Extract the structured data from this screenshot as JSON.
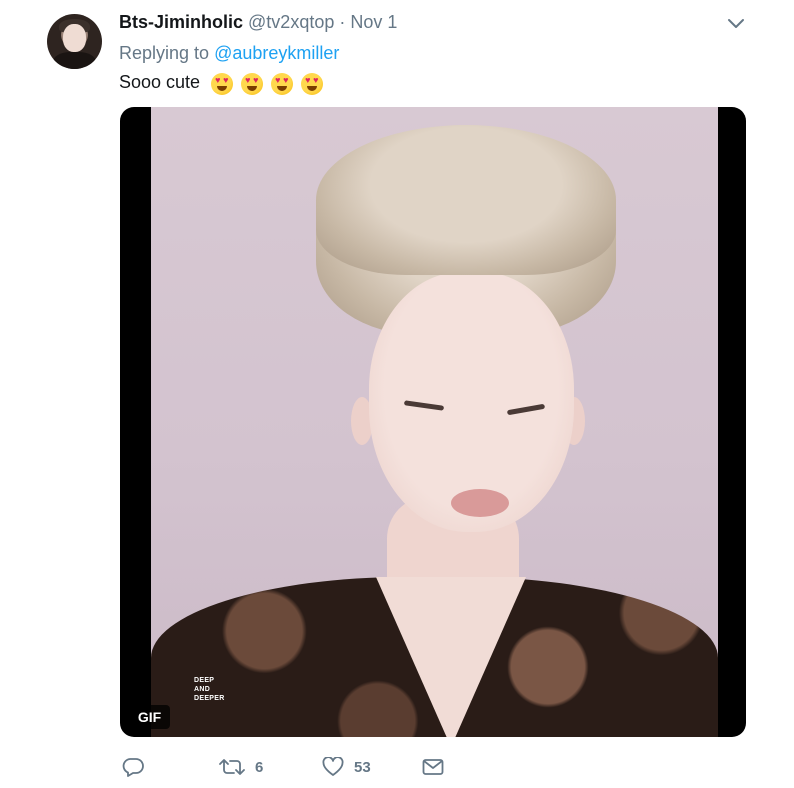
{
  "tweet": {
    "display_name": "Bts-Jiminholic",
    "handle": "@tv2xqtop",
    "separator": "·",
    "date": "Nov 1",
    "replying_prefix": "Replying to",
    "replying_to": "@aubreykmiller",
    "text": "Sooo cute",
    "emoji": [
      "heart-eyes-emoji",
      "heart-eyes-emoji",
      "heart-eyes-emoji",
      "heart-eyes-emoji"
    ]
  },
  "media": {
    "badge": "GIF",
    "watermark_lines": [
      "DEEP",
      "AND",
      "DEEPER"
    ]
  },
  "actions": {
    "reply_icon": "reply-icon",
    "retweet_icon": "retweet-icon",
    "retweet_count": "6",
    "like_icon": "heart-icon",
    "like_count": "53",
    "dm_icon": "envelope-icon"
  },
  "colors": {
    "link": "#1da1f2",
    "muted": "#657786",
    "text": "#14171a"
  }
}
